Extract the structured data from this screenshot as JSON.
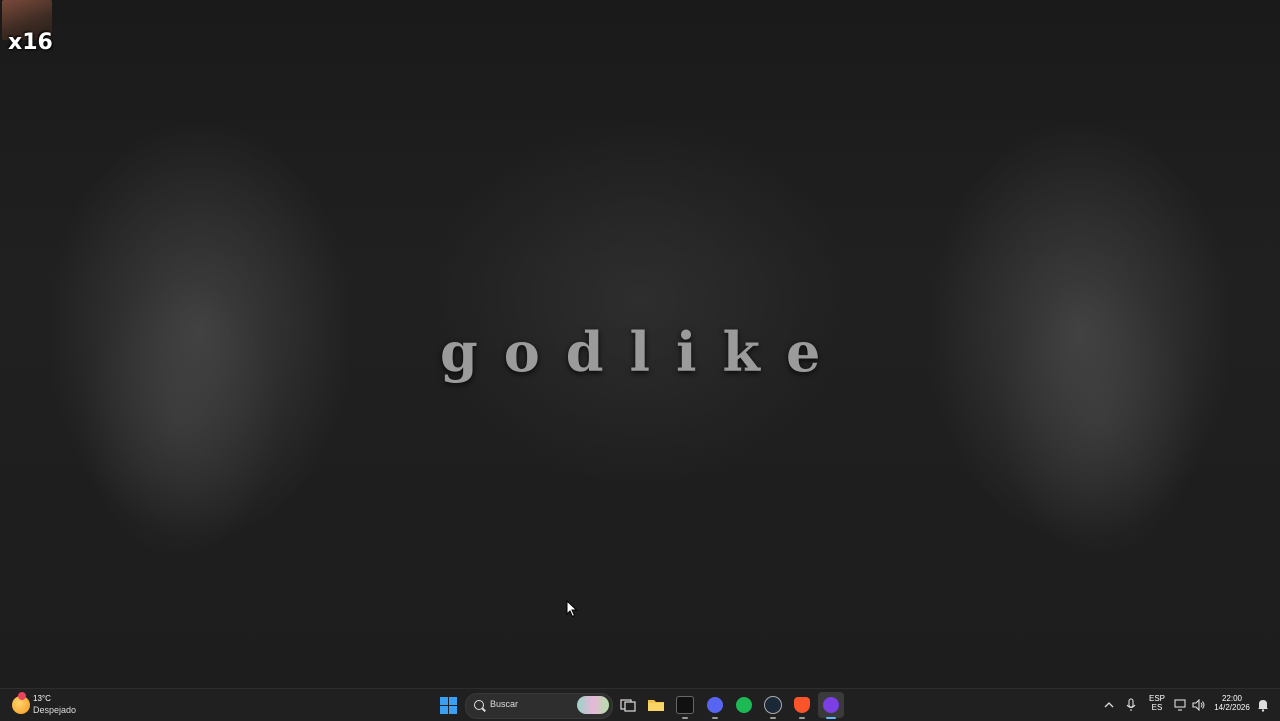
{
  "desktop": {
    "wallpaper_text": "godlike",
    "shortcut_label": "x16"
  },
  "taskbar": {
    "weather": {
      "temperature": "13°C",
      "condition": "Despejado",
      "icon": "sun-icon"
    },
    "search": {
      "placeholder": "Buscar"
    },
    "apps": [
      {
        "name": "task-view",
        "icon": "task-view-icon"
      },
      {
        "name": "file-explorer",
        "icon": "folder-icon"
      },
      {
        "name": "chillfy",
        "icon": "app-icon"
      },
      {
        "name": "discord",
        "icon": "discord-icon"
      },
      {
        "name": "spotify",
        "icon": "spotify-icon"
      },
      {
        "name": "steam",
        "icon": "steam-icon"
      },
      {
        "name": "brave",
        "icon": "brave-icon"
      },
      {
        "name": "obs",
        "icon": "obs-icon"
      }
    ],
    "tray": {
      "language_top": "ESP",
      "language_bottom": "ES",
      "time": "22:00",
      "date": "14/2/2026"
    }
  },
  "colors": {
    "taskbar_bg": "#202020",
    "accent": "#60b7ff"
  }
}
